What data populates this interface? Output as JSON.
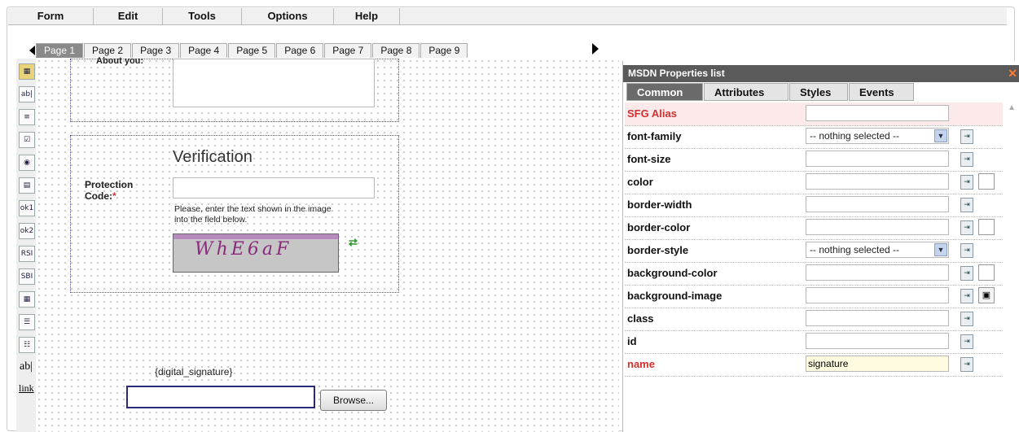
{
  "menu": [
    "Form",
    "Edit",
    "Tools",
    "Options",
    "Help"
  ],
  "tabs": [
    "Page 1",
    "Page 2",
    "Page 3",
    "Page 4",
    "Page 5",
    "Page 6",
    "Page 7",
    "Page 8",
    "Page 9"
  ],
  "form": {
    "about_label": "About you:",
    "verification_heading": "Verification",
    "protection_label_line1": "Protection",
    "protection_label_line2": "Code:",
    "required_mark": "*",
    "hint_line1": "Please, enter the text shown in the image",
    "hint_line2": "into the field below.",
    "captcha_text": "WhE6aF",
    "digital_signature_label": "{digital_signature}",
    "browse_label": "Browse..."
  },
  "toolbox": [
    "ok1",
    "ok2",
    "RSI",
    "SBI",
    "ab|",
    "link"
  ],
  "panel": {
    "title": "MSDN Properties list",
    "tabs": [
      "Common",
      "Attributes",
      "Styles",
      "Events"
    ],
    "rows": [
      {
        "name": "SFG Alias",
        "value": ""
      },
      {
        "name": "font-family",
        "value": "-- nothing selected --"
      },
      {
        "name": "font-size",
        "value": ""
      },
      {
        "name": "color",
        "value": ""
      },
      {
        "name": "border-width",
        "value": ""
      },
      {
        "name": "border-color",
        "value": ""
      },
      {
        "name": "border-style",
        "value": "-- nothing selected --"
      },
      {
        "name": "background-color",
        "value": ""
      },
      {
        "name": "background-image",
        "value": ""
      },
      {
        "name": "class",
        "value": ""
      },
      {
        "name": "id",
        "value": ""
      },
      {
        "name": "name",
        "value": "signature"
      }
    ]
  },
  "colors": {
    "active_tab": "#8a8a8a",
    "panel_header": "#5a5a5a",
    "alias_row": "#fce9ea",
    "required_red": "#d13030"
  }
}
